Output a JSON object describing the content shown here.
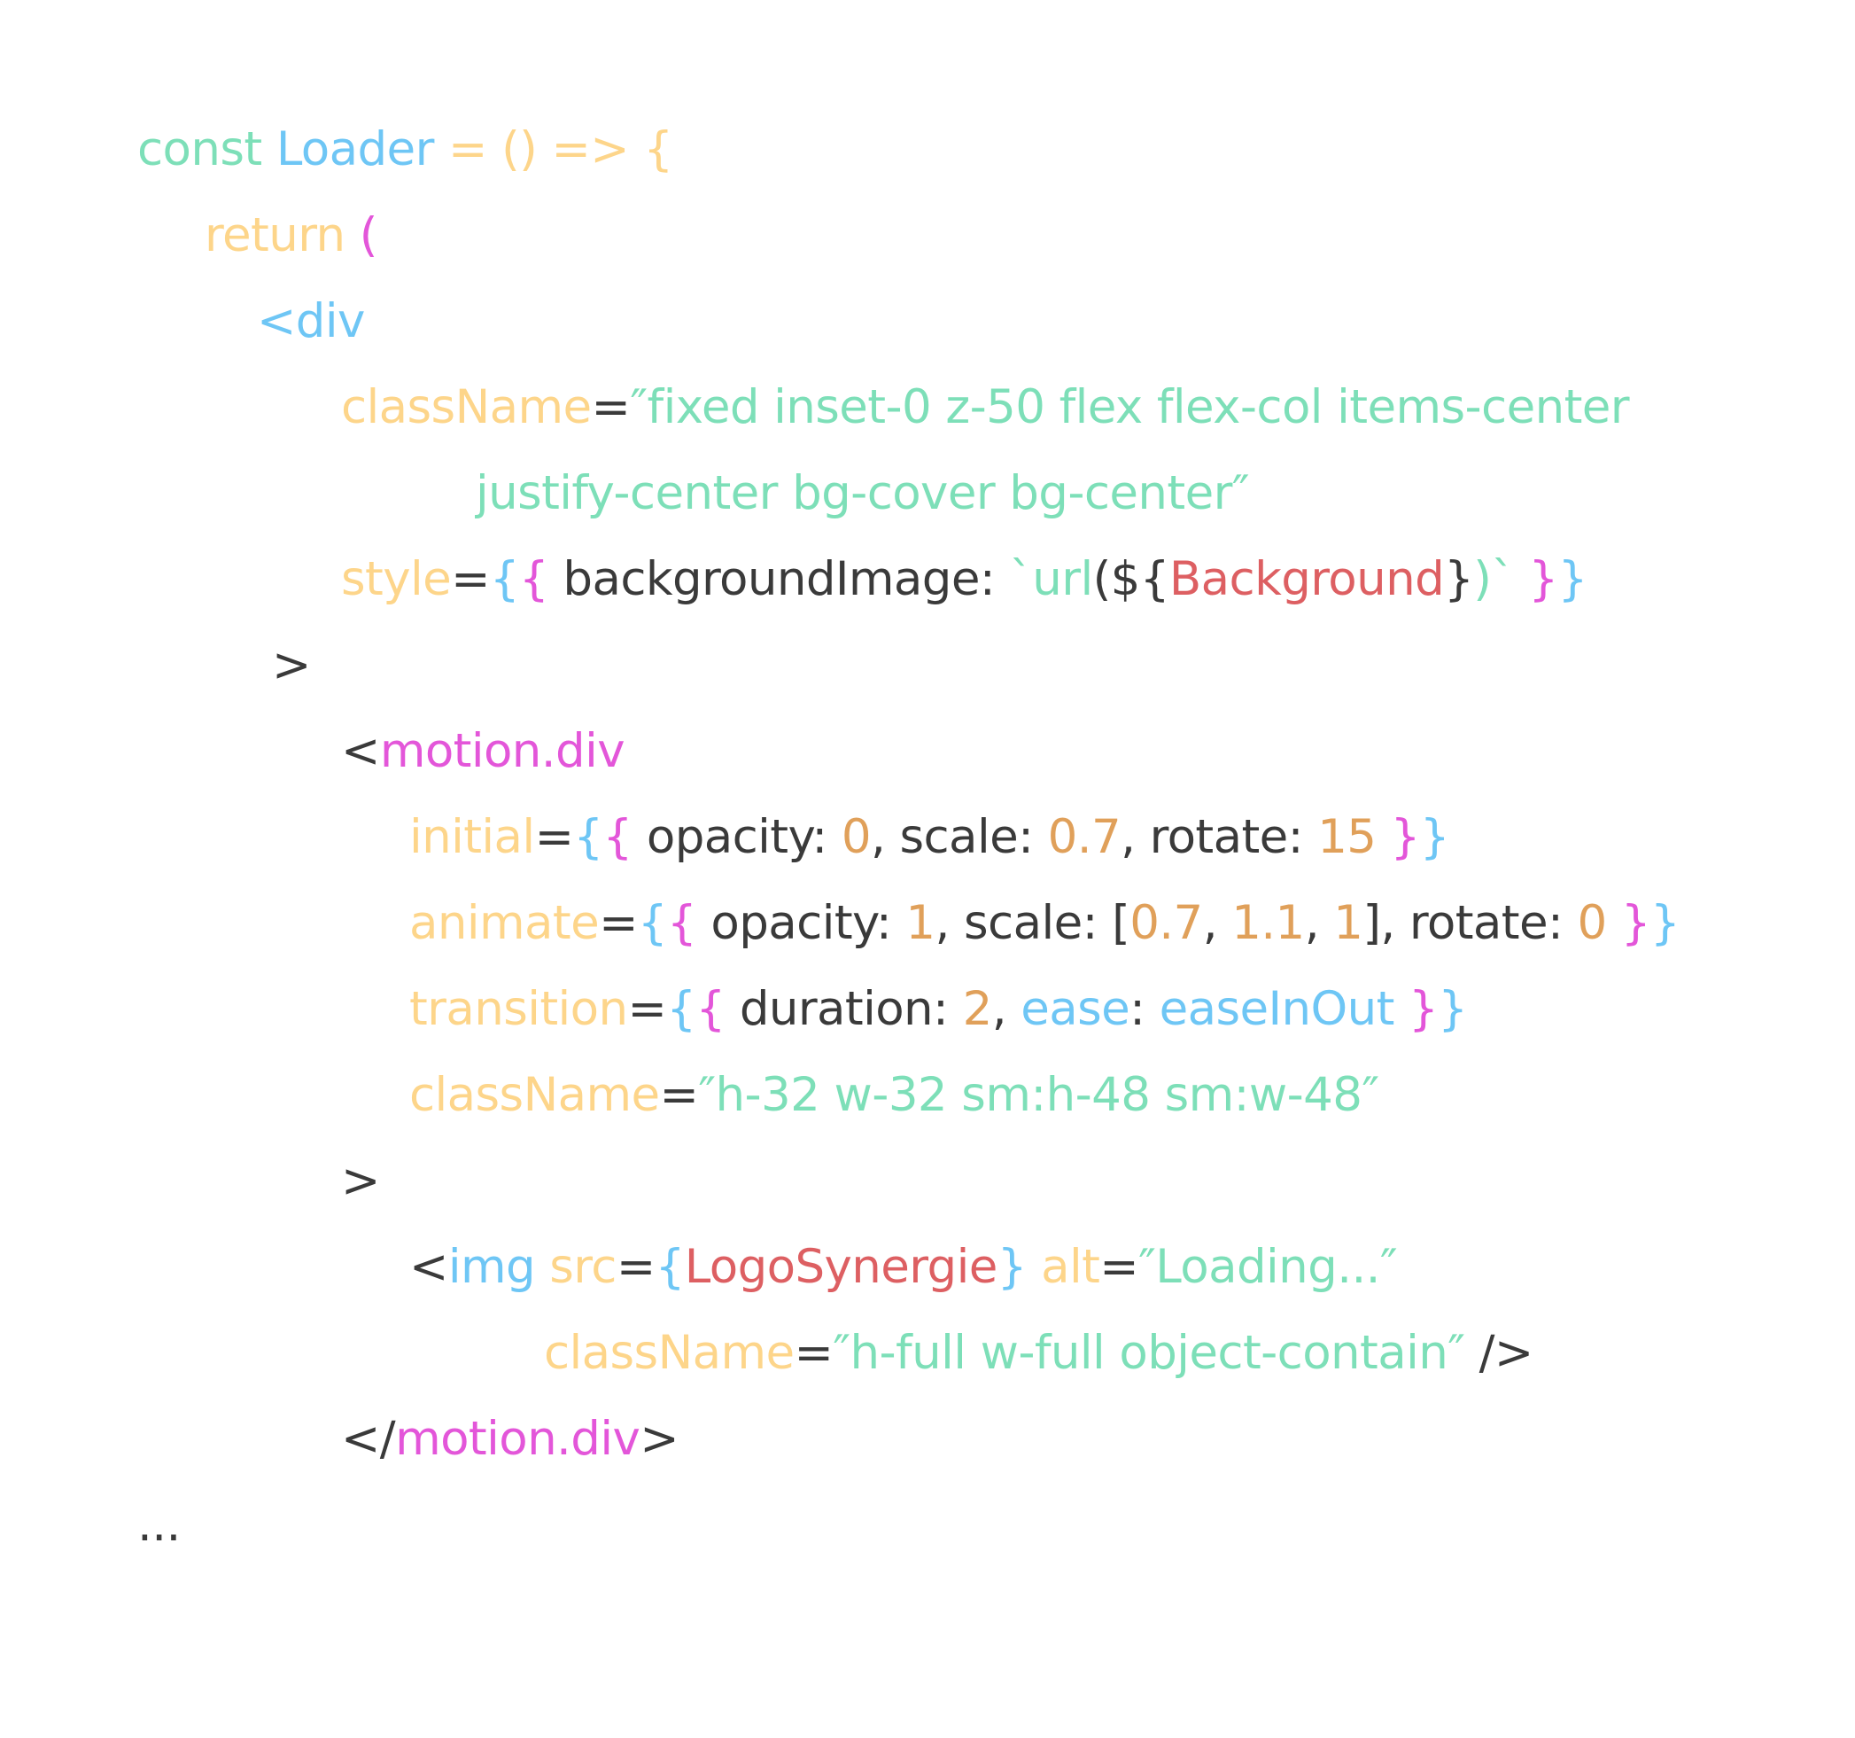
{
  "colors": {
    "green": "#7DDFB8",
    "yellow": "#FDD58A",
    "blue": "#6EC6F5",
    "magenta": "#E356D9",
    "dark": "#3A3A3A",
    "orange": "#E0A05A",
    "red": "#DD5F62"
  },
  "code": {
    "lines": [
      {
        "tokens": [
          {
            "text": "const ",
            "color": "green"
          },
          {
            "text": "Loader",
            "color": "blue"
          },
          {
            "text": " = () => {",
            "color": "yellow"
          }
        ]
      },
      {
        "tokens": [
          {
            "text": "return ",
            "color": "yellow"
          },
          {
            "text": "(",
            "color": "magenta"
          }
        ]
      },
      {
        "tokens": [
          {
            "text": "<div",
            "color": "blue"
          }
        ]
      },
      {
        "tokens": [
          {
            "text": "className",
            "color": "yellow"
          },
          {
            "text": "=",
            "color": "dark"
          },
          {
            "text": "″fixed inset-0 z-50 flex flex-col items-center",
            "color": "green"
          }
        ]
      },
      {
        "tokens": [
          {
            "text": "justify-center bg-cover bg-center″",
            "color": "green"
          }
        ]
      },
      {
        "tokens": [
          {
            "text": "style",
            "color": "yellow"
          },
          {
            "text": "=",
            "color": "dark"
          },
          {
            "text": "{",
            "color": "blue"
          },
          {
            "text": "{",
            "color": "magenta"
          },
          {
            "text": " backgroundImage: ",
            "color": "dark"
          },
          {
            "text": "`url",
            "color": "green"
          },
          {
            "text": "(${",
            "color": "dark"
          },
          {
            "text": "Background",
            "color": "red"
          },
          {
            "text": "}",
            "color": "dark"
          },
          {
            "text": ")`",
            "color": "green"
          },
          {
            "text": " }",
            "color": "magenta"
          },
          {
            "text": "}",
            "color": "blue"
          }
        ]
      },
      {
        "tokens": [
          {
            "text": ">",
            "color": "dark"
          }
        ]
      },
      {
        "tokens": [
          {
            "text": "<",
            "color": "dark"
          },
          {
            "text": "motion.div",
            "color": "magenta"
          }
        ]
      },
      {
        "tokens": [
          {
            "text": "initial",
            "color": "yellow"
          },
          {
            "text": "=",
            "color": "dark"
          },
          {
            "text": "{",
            "color": "blue"
          },
          {
            "text": "{",
            "color": "magenta"
          },
          {
            "text": " opacity: ",
            "color": "dark"
          },
          {
            "text": "0",
            "color": "orange"
          },
          {
            "text": ", scale: ",
            "color": "dark"
          },
          {
            "text": "0.7",
            "color": "orange"
          },
          {
            "text": ", rotate: ",
            "color": "dark"
          },
          {
            "text": "15",
            "color": "orange"
          },
          {
            "text": " }",
            "color": "magenta"
          },
          {
            "text": "}",
            "color": "blue"
          }
        ]
      },
      {
        "tokens": [
          {
            "text": "animate",
            "color": "yellow"
          },
          {
            "text": "=",
            "color": "dark"
          },
          {
            "text": "{",
            "color": "blue"
          },
          {
            "text": "{",
            "color": "magenta"
          },
          {
            "text": " opacity: ",
            "color": "dark"
          },
          {
            "text": "1",
            "color": "orange"
          },
          {
            "text": ", scale: [",
            "color": "dark"
          },
          {
            "text": "0.7",
            "color": "orange"
          },
          {
            "text": ", ",
            "color": "dark"
          },
          {
            "text": "1.1",
            "color": "orange"
          },
          {
            "text": ", ",
            "color": "dark"
          },
          {
            "text": "1",
            "color": "orange"
          },
          {
            "text": "], rotate: ",
            "color": "dark"
          },
          {
            "text": "0",
            "color": "orange"
          },
          {
            "text": " }",
            "color": "magenta"
          },
          {
            "text": "}",
            "color": "blue"
          }
        ]
      },
      {
        "tokens": [
          {
            "text": "transition",
            "color": "yellow"
          },
          {
            "text": "=",
            "color": "dark"
          },
          {
            "text": "{",
            "color": "blue"
          },
          {
            "text": "{",
            "color": "magenta"
          },
          {
            "text": " duration: ",
            "color": "dark"
          },
          {
            "text": "2",
            "color": "orange"
          },
          {
            "text": ", ",
            "color": "dark"
          },
          {
            "text": "ease",
            "color": "blue"
          },
          {
            "text": ": ",
            "color": "dark"
          },
          {
            "text": "easeInOut",
            "color": "blue"
          },
          {
            "text": " }",
            "color": "magenta"
          },
          {
            "text": "}",
            "color": "blue"
          }
        ]
      },
      {
        "tokens": [
          {
            "text": "className",
            "color": "yellow"
          },
          {
            "text": "=",
            "color": "dark"
          },
          {
            "text": "″h-32 w-32 sm:h-48 sm:w-48″",
            "color": "green"
          }
        ]
      },
      {
        "tokens": [
          {
            "text": ">",
            "color": "dark"
          }
        ]
      },
      {
        "tokens": [
          {
            "text": "<",
            "color": "dark"
          },
          {
            "text": "img ",
            "color": "blue"
          },
          {
            "text": "src",
            "color": "yellow"
          },
          {
            "text": "=",
            "color": "dark"
          },
          {
            "text": "{",
            "color": "blue"
          },
          {
            "text": "LogoSynergie",
            "color": "red"
          },
          {
            "text": "}",
            "color": "blue"
          },
          {
            "text": " alt",
            "color": "yellow"
          },
          {
            "text": "=",
            "color": "dark"
          },
          {
            "text": "″Loading...″",
            "color": "green"
          }
        ]
      },
      {
        "tokens": [
          {
            "text": "className",
            "color": "yellow"
          },
          {
            "text": "=",
            "color": "dark"
          },
          {
            "text": "″h-full w-full object-contain″",
            "color": "green"
          },
          {
            "text": " />",
            "color": "dark"
          }
        ]
      },
      {
        "tokens": [
          {
            "text": "</",
            "color": "dark"
          },
          {
            "text": "motion.div",
            "color": "magenta"
          },
          {
            "text": ">",
            "color": "dark"
          }
        ]
      },
      {
        "tokens": [
          {
            "text": "...",
            "color": "dark"
          }
        ]
      }
    ]
  }
}
